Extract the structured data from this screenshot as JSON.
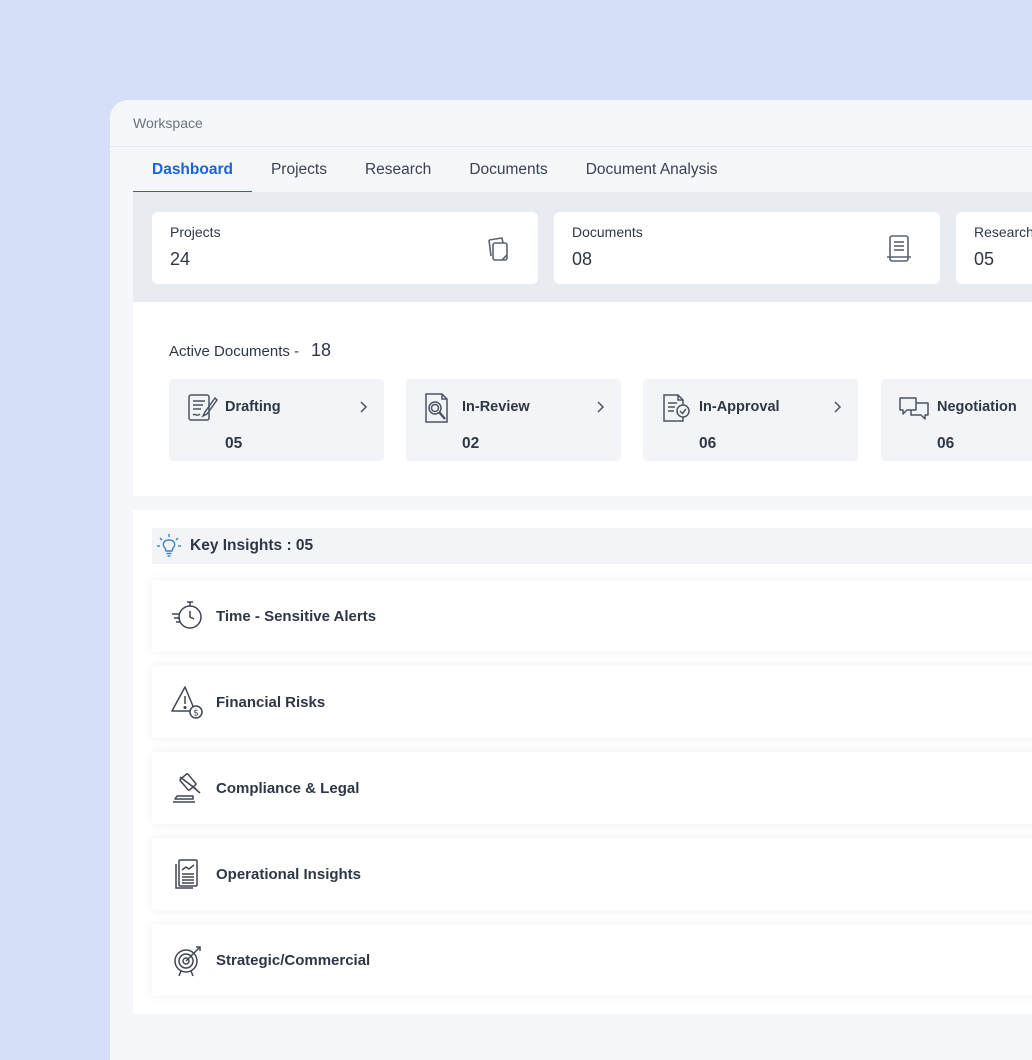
{
  "window": {
    "title": "Workspace"
  },
  "tabs": [
    {
      "label": "Dashboard",
      "active": true
    },
    {
      "label": "Projects",
      "active": false
    },
    {
      "label": "Research",
      "active": false
    },
    {
      "label": "Documents",
      "active": false
    },
    {
      "label": "Document Analysis",
      "active": false
    }
  ],
  "stats": [
    {
      "label": "Projects",
      "value": "24",
      "icon": "copy-icon"
    },
    {
      "label": "Documents",
      "value": "08",
      "icon": "document-icon"
    },
    {
      "label": "Research",
      "value": "05",
      "icon": "research-icon"
    }
  ],
  "active_documents": {
    "label": "Active Documents -",
    "count": "18",
    "statuses": [
      {
        "label": "Drafting",
        "value": "05",
        "icon": "drafting-icon"
      },
      {
        "label": "In-Review",
        "value": "02",
        "icon": "review-search-icon"
      },
      {
        "label": "In-Approval",
        "value": "06",
        "icon": "approval-icon"
      },
      {
        "label": "Negotiation",
        "value": "06",
        "icon": "chat-bubbles-icon"
      }
    ]
  },
  "insights": {
    "title": "Key Insights : 05",
    "items": [
      {
        "label": "Time - Sensitive Alerts",
        "icon": "stopwatch-icon"
      },
      {
        "label": "Financial Risks",
        "icon": "warning-dollar-icon"
      },
      {
        "label": "Compliance & Legal",
        "icon": "gavel-icon"
      },
      {
        "label": "Operational Insights",
        "icon": "report-icon"
      },
      {
        "label": "Strategic/Commercial",
        "icon": "target-icon"
      }
    ]
  },
  "colors": {
    "background": "#d5dff7",
    "accent": "#1b63d6",
    "card": "#ffffff",
    "band": "#e8ebf0",
    "text": "#2f3746"
  }
}
